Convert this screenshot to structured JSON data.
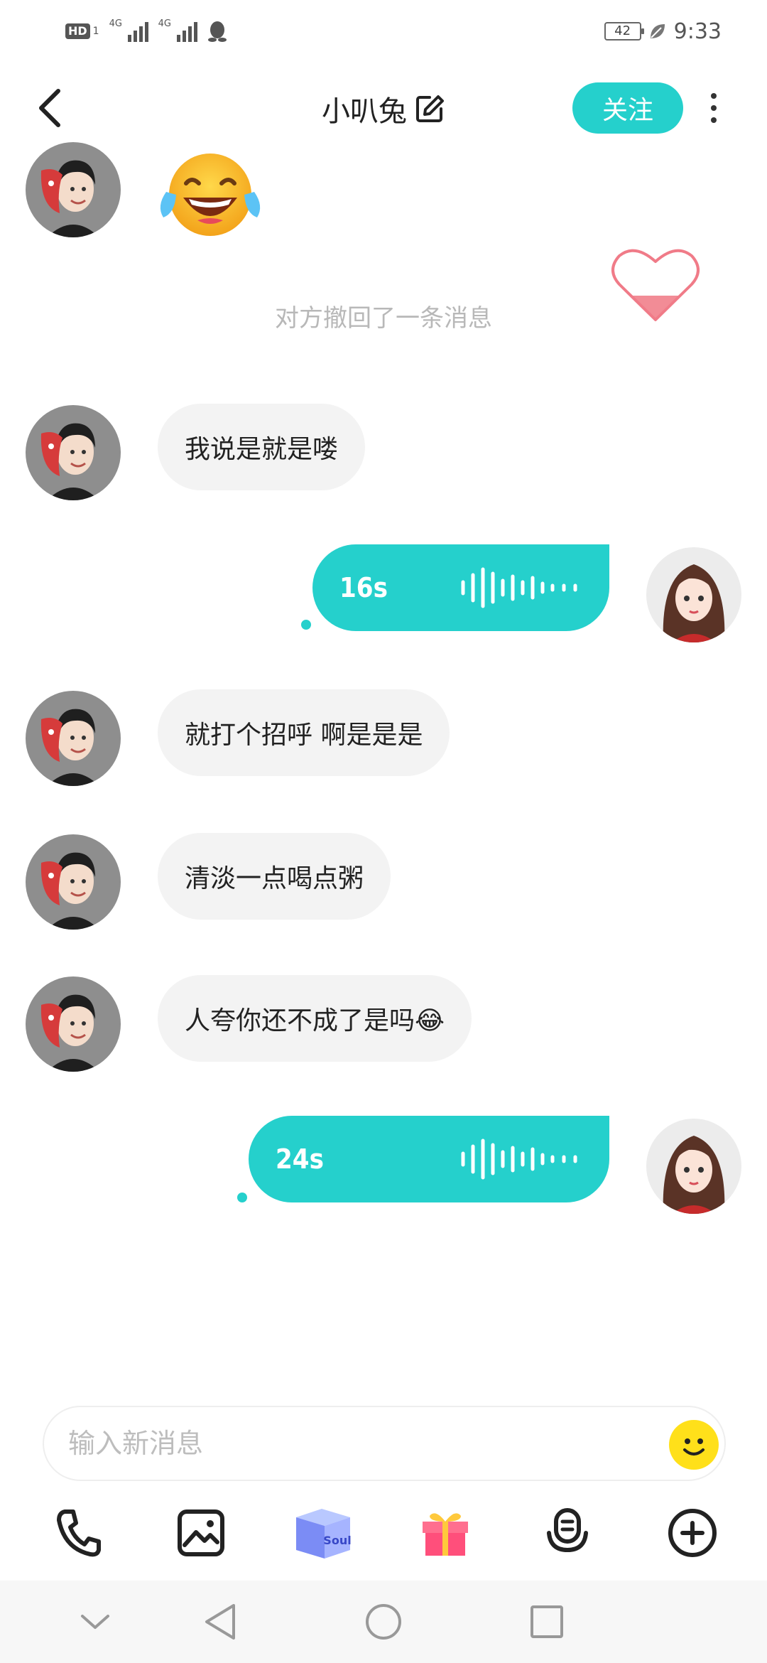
{
  "status_bar": {
    "hd_badge": "HD",
    "sim_number": "1",
    "signal_1_label": "4G",
    "signal_2_label": "4G",
    "battery_level": "42",
    "time": "9:33"
  },
  "header": {
    "title": "小叭兔",
    "follow_label": "关注"
  },
  "messages": {
    "emoji_message": "😂",
    "recall_notice": "对方撤回了一条消息",
    "incoming_1": "我说是就是喽",
    "voice_1_duration": "16s",
    "incoming_2": "就打个招呼 啊是是是",
    "incoming_3": "清淡一点喝点粥",
    "incoming_4": "人夸你还不成了是吗😂",
    "voice_2_duration": "24s"
  },
  "input": {
    "placeholder": "输入新消息"
  },
  "toolbar": {
    "items": [
      "phone-icon",
      "image-icon",
      "soul-box-icon",
      "gift-icon",
      "voice-bubble-icon",
      "plus-icon"
    ],
    "soul_box_text": "Soul"
  },
  "colors": {
    "accent": "#25d0cc",
    "incoming_bubble": "#f3f3f3",
    "recall_text": "#b8b8b8"
  }
}
